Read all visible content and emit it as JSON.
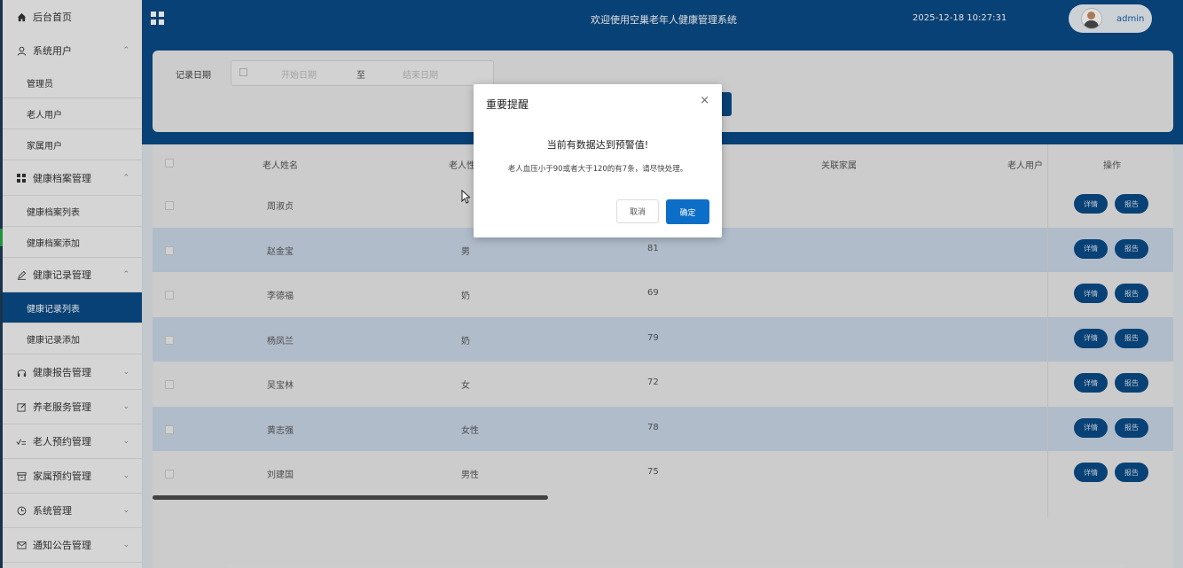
{
  "sidebar": {
    "home": "后台首页",
    "system_users": "系统用户",
    "admin": "管理员",
    "elderly_users": "老人用户",
    "family_users": "家属用户",
    "health_archive": "健康档案管理",
    "archive_list": "健康档案列表",
    "archive_add": "健康档案添加",
    "health_record": "健康记录管理",
    "record_list": "健康记录列表",
    "record_add": "健康记录添加",
    "health_report": "健康报告管理",
    "elder_service": "养老服务管理",
    "elder_booking": "老人预约管理",
    "family_booking": "家属预约管理",
    "system_manage": "系统管理",
    "notice_manage": "通知公告管理",
    "expand_arrow": "⌃",
    "collapse_arrow": "⌄"
  },
  "header": {
    "welcome": "欢迎使用空巢老年人健康管理系统",
    "datetime": "2025-12-18 10:27:31",
    "username": "admin"
  },
  "search": {
    "date_label": "记录日期",
    "start_placeholder": "开始日期",
    "separator": "至",
    "end_placeholder": "结束日期"
  },
  "table": {
    "headers": {
      "name": "老人姓名",
      "gender": "老人性",
      "family": "关联家属",
      "user": "老人用户",
      "ops": "操作"
    },
    "rows": [
      {
        "name": "周淑贞",
        "gender": "",
        "value": ""
      },
      {
        "name": "赵金宝",
        "gender": "男",
        "value": "81"
      },
      {
        "name": "李德福",
        "gender": "奶",
        "value": "69"
      },
      {
        "name": "杨凤兰",
        "gender": "奶",
        "value": "79"
      },
      {
        "name": "吴宝林",
        "gender": "女",
        "value": "72"
      },
      {
        "name": "黄志强",
        "gender": "女性",
        "value": "78"
      },
      {
        "name": "刘建国",
        "gender": "男性",
        "value": "75"
      }
    ],
    "detail_label": "详情",
    "report_label": "报告"
  },
  "modal": {
    "title": "重要提醒",
    "close": "×",
    "headline": "当前有数据达到预警值!",
    "message": "老人血压小于90或者大于120的有7条，请尽快处理。",
    "cancel": "取消",
    "confirm": "确定"
  },
  "colors": {
    "primary": "#0a4a86",
    "confirm": "#0d6ec7",
    "row_alt": "#c9d6e6"
  }
}
